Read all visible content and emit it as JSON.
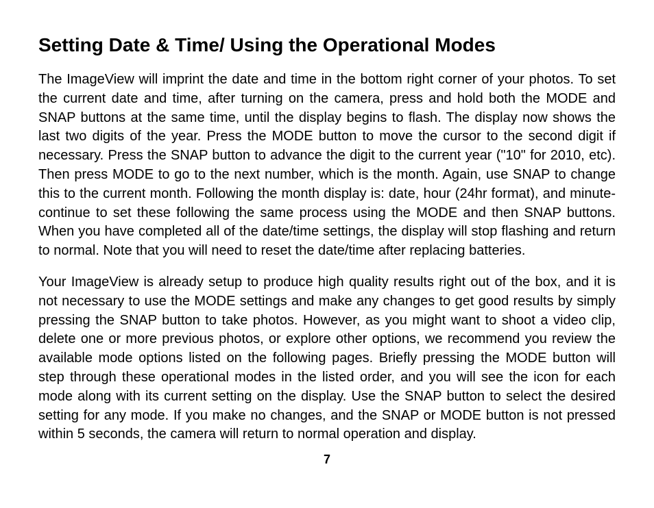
{
  "heading": "Setting Date & Time/ Using the Operational Modes",
  "paragraphs": {
    "p1": "The ImageView will imprint the date and time in the bottom right corner of your photos. To set the current date and time, after turning on the camera, press and hold both the MODE and SNAP buttons at the same time, until the display begins to flash. The display now shows the last two digits of the year. Press the MODE button to move the cursor to the second digit if necessary. Press the SNAP button to advance the digit to the current year (\"10\" for 2010, etc). Then press MODE to go to the next number, which is the month. Again, use SNAP to change this to the current month. Following the month display is: date, hour (24hr format), and minute-continue to set these following the same process using the MODE and then SNAP buttons. When you have completed all of the date/time settings, the display will stop flashing and return to normal.  Note that you will need to reset the date/time after replacing batteries.",
    "p2": "Your ImageView is already setup to produce high quality results right out of the box, and it is not necessary to use the MODE settings and make any changes to get good results by simply pressing the SNAP button to take photos. However, as you might want to shoot a video clip, delete one or more previous photos, or explore other options, we recommend you review the available mode options listed on the following pages. Briefly pressing the MODE button will step through these operational modes in the listed order, and you will see the icon for each mode along with its current setting on the display. Use the SNAP button to select the desired setting for any mode. If you make no changes, and the SNAP or MODE button is not pressed within 5 seconds, the camera will return to normal operation and display."
  },
  "page_number": "7"
}
